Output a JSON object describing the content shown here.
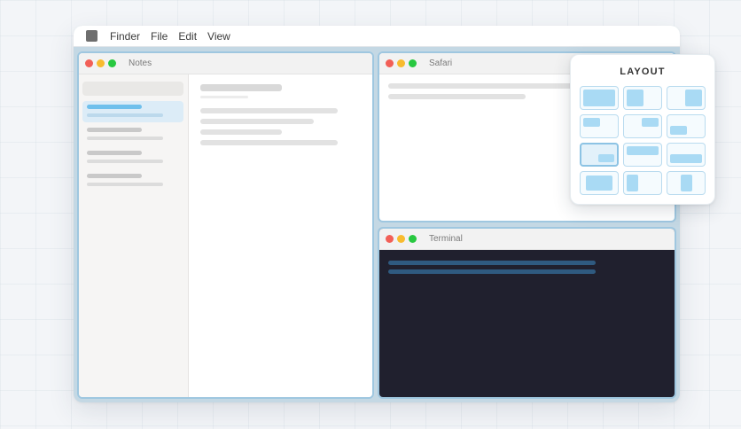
{
  "menubar": {
    "items": [
      {
        "label": "Finder"
      },
      {
        "label": "File"
      },
      {
        "label": "Edit"
      },
      {
        "label": "View"
      }
    ]
  },
  "windows": {
    "notes": {
      "title": "Notes"
    },
    "safari": {
      "title": "Safari"
    },
    "terminal": {
      "title": "Terminal"
    }
  },
  "layout_panel": {
    "title": "LAYOUT",
    "options": [
      {
        "id": "full",
        "selected": false
      },
      {
        "id": "left-half",
        "selected": false
      },
      {
        "id": "right-half",
        "selected": false
      },
      {
        "id": "top-left-quarter",
        "selected": false
      },
      {
        "id": "top-right-quarter",
        "selected": false
      },
      {
        "id": "bottom-left-quarter",
        "selected": false
      },
      {
        "id": "bottom-right-quarter",
        "selected": true
      },
      {
        "id": "top-half",
        "selected": false
      },
      {
        "id": "bottom-half",
        "selected": false
      },
      {
        "id": "center",
        "selected": false
      },
      {
        "id": "left-third",
        "selected": false
      },
      {
        "id": "center-third",
        "selected": false
      }
    ]
  },
  "colors": {
    "accent": "#9fc7e0",
    "tile_fill": "#a9daf4",
    "terminal_bg": "#20202e",
    "terminal_line": "#2f5a80",
    "close": "#f25f57",
    "minimize": "#f8bb2e",
    "maximize": "#28c840"
  }
}
